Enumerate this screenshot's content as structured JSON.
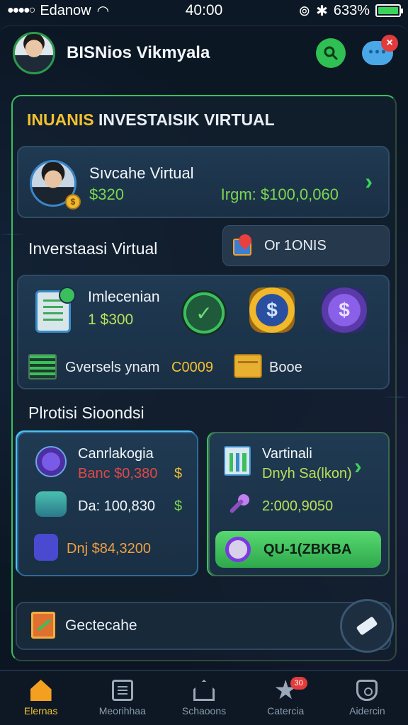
{
  "status_bar": {
    "carrier": "Edanow",
    "time": "40:00",
    "battery": "633%"
  },
  "header": {
    "title": "BISNios Vikmyala",
    "search_icon": "search-icon",
    "chat_icon": "chat-icon",
    "close_badge": "×"
  },
  "panel": {
    "title_accent": "INUANIS",
    "title_rest": " INVESTAISIK VIRTUAL"
  },
  "account": {
    "name": "Sıvcahe Virtual",
    "balance": "$320",
    "target": "Irgm: $100,0,060",
    "coin_symbol": "$"
  },
  "investment": {
    "section_title": "Inverstaasi Virtual",
    "options_label": "Or 1ONIS",
    "label": "Imlecenian",
    "amount": "1 $300",
    "overview_label": "Gversels ynam",
    "overview_value": "C0009",
    "boost_label": "Booe"
  },
  "promo": {
    "title": "Plrotisi Sioondsi",
    "left": {
      "name": "Canrlakogia",
      "line1": "Banc $0,380",
      "line1_suffix": "$",
      "line2": "Da: 100,830",
      "line2_suffix": "$",
      "line3": "Dnj $84,3200"
    },
    "right": {
      "name": "Vartinali",
      "subtitle": "Dnyh Sa(lkon)",
      "value": "2:000,9050",
      "cta_label": "QU-1(ZBKBA"
    }
  },
  "bottom": {
    "label": "Gectecahe"
  },
  "tabs": [
    {
      "label": "Elernas",
      "active": true
    },
    {
      "label": "Meorihhaa",
      "active": false
    },
    {
      "label": "Schaoons",
      "active": false
    },
    {
      "label": "Catercia",
      "active": false,
      "badge": "30"
    },
    {
      "label": "Aidercin",
      "active": false
    }
  ],
  "colors": {
    "accent_green": "#3bbf5e",
    "accent_gold": "#f3c130",
    "negative_red": "#e04848",
    "background": "#0b1622"
  }
}
